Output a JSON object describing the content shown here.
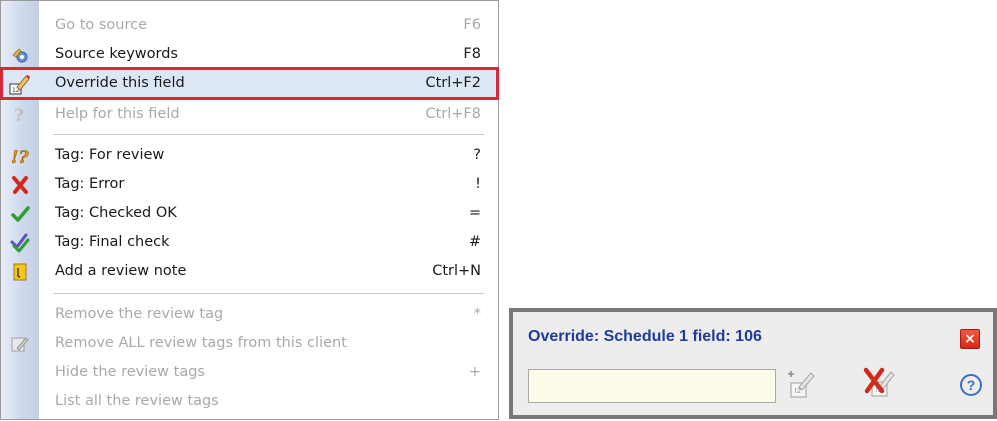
{
  "menu": {
    "items": [
      {
        "label": "Go to source",
        "shortcut": "F6",
        "icon": "none",
        "disabled": true
      },
      {
        "label": "Source keywords",
        "shortcut": "F8",
        "icon": "keywords-icon",
        "disabled": false
      },
      {
        "label": "Override this field",
        "shortcut": "Ctrl+F2",
        "icon": "override-pencil-icon",
        "disabled": false,
        "highlighted": true
      },
      {
        "label": "Help for this field",
        "shortcut": "Ctrl+F8",
        "icon": "help-question-icon",
        "disabled": true
      },
      {
        "label": "Tag: For review",
        "shortcut": "?",
        "icon": "review-question-icon",
        "disabled": false
      },
      {
        "label": "Tag: Error",
        "shortcut": "!",
        "icon": "red-x-icon",
        "disabled": false
      },
      {
        "label": "Tag: Checked OK",
        "shortcut": "=",
        "icon": "green-check-icon",
        "disabled": false
      },
      {
        "label": "Tag: Final check",
        "shortcut": "#",
        "icon": "double-check-icon",
        "disabled": false
      },
      {
        "label": "Add a review note",
        "shortcut": "Ctrl+N",
        "icon": "review-note-icon",
        "disabled": false
      },
      {
        "label": "Remove the review tag",
        "shortcut": "*",
        "icon": "none",
        "disabled": true
      },
      {
        "label": "Remove ALL review tags from this client",
        "shortcut": "",
        "icon": "remove-all-tags-icon",
        "disabled": true
      },
      {
        "label": "Hide the review tags",
        "shortcut": "+",
        "icon": "none",
        "disabled": true
      },
      {
        "label": "List all the review tags",
        "shortcut": "",
        "icon": "none",
        "disabled": true
      }
    ]
  },
  "dialog": {
    "title": "Override: Schedule 1 field: 106",
    "close_label": "×",
    "input_value": "",
    "help_label": "?"
  },
  "colors": {
    "highlight_border": "#d8283d",
    "highlight_fill": "#dce7f6",
    "dialog_title": "#1f3c9b",
    "input_bg": "#fdfbe9"
  }
}
